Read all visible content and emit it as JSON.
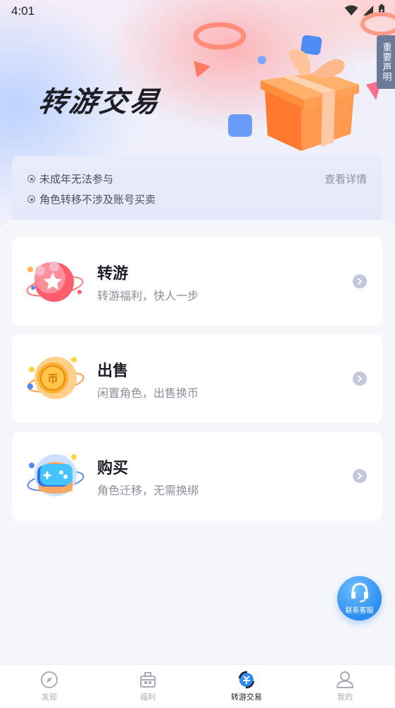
{
  "status_bar": {
    "time": "4:01"
  },
  "hero": {
    "title": "转游交易",
    "notice_tab": "重要声明"
  },
  "tips": {
    "items": [
      "未成年无法参与",
      "角色转移不涉及账号买卖"
    ],
    "link": "查看详情"
  },
  "cards": [
    {
      "title": "转游",
      "subtitle": "转游福利，快人一步",
      "icon": "star-planet-icon"
    },
    {
      "title": "出售",
      "subtitle": "闲置角色，出售换币",
      "icon": "coin-planet-icon"
    },
    {
      "title": "购买",
      "subtitle": "角色迁移，无需换绑",
      "icon": "gamepad-planet-icon"
    }
  ],
  "service": {
    "label": "联系客服"
  },
  "tabbar": {
    "items": [
      {
        "label": "发现",
        "icon": "compass-icon"
      },
      {
        "label": "福利",
        "icon": "gift-box-icon"
      },
      {
        "label": "转游交易",
        "icon": "exchange-icon"
      },
      {
        "label": "我的",
        "icon": "user-icon"
      }
    ],
    "active_index": 2
  },
  "colors": {
    "accent": "#2c8cf2",
    "gift": "#ff8a3d",
    "text_primary": "#1d1f27",
    "text_secondary": "#8b8f9c"
  }
}
